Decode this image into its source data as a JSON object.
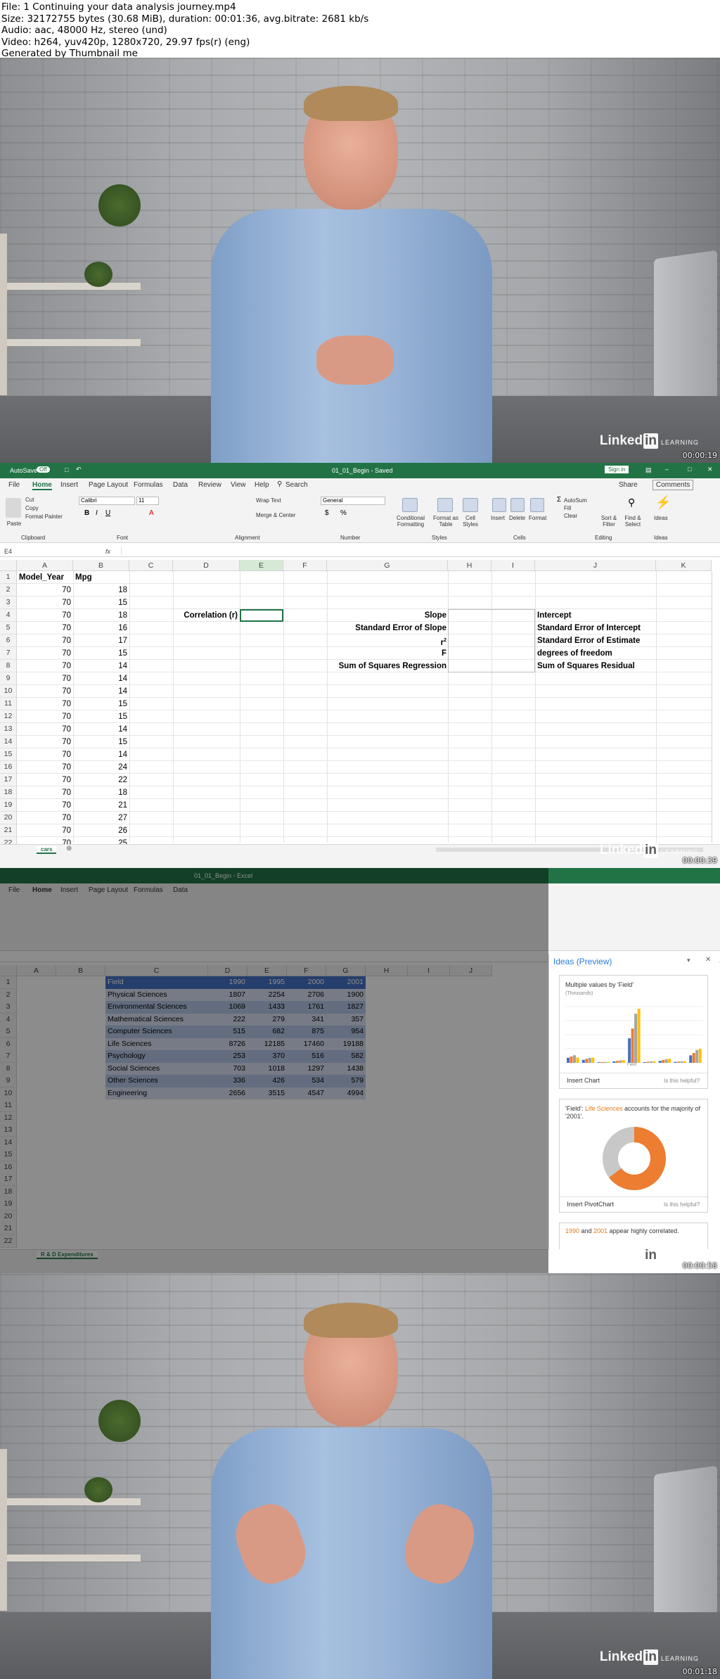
{
  "info": {
    "file": "File: 1 Continuing your data analysis journey.mp4",
    "size": "Size: 32172755 bytes (30.68 MiB), duration: 00:01:36, avg.bitrate: 2681 kb/s",
    "audio": "Audio: aac, 48000 Hz, stereo (und)",
    "video": "Video: h264, yuv420p, 1280x720, 29.97 fps(r) (eng)",
    "generator": "Generated by Thumbnail me"
  },
  "branding": {
    "logo": "Linked",
    "logo_in": "in",
    "logo_sub": "LEARNING"
  },
  "frames": [
    {
      "timestamp": "00:00:19"
    },
    {
      "timestamp": "00:00:39"
    },
    {
      "timestamp": "00:00:58"
    },
    {
      "timestamp": "00:01:18"
    }
  ],
  "excel": {
    "autosave": "AutoSave",
    "autosave_state": "Off",
    "doc_title": "01_01_Begin - Saved",
    "sign_in": "Sign in",
    "tabs": [
      "File",
      "Home",
      "Insert",
      "Page Layout",
      "Formulas",
      "Data",
      "Review",
      "View",
      "Help",
      "Search"
    ],
    "share": "Share",
    "comments": "Comments",
    "ribbon": {
      "paste": "Paste",
      "cut": "Cut",
      "copy": "Copy",
      "format_painter": "Format Painter",
      "clipboard": "Clipboard",
      "font_name": "Calibri",
      "font_size": "11",
      "font": "Font",
      "wrap_text": "Wrap Text",
      "merge_center": "Merge & Center",
      "alignment": "Alignment",
      "number_format": "General",
      "number": "Number",
      "conditional": "Conditional Formatting",
      "format_table": "Format as Table",
      "cell_styles": "Cell Styles",
      "styles": "Styles",
      "insert": "Insert",
      "delete": "Delete",
      "format": "Format",
      "cells": "Cells",
      "autosum": "AutoSum",
      "fill": "Fill",
      "clear": "Clear",
      "sort_filter": "Sort & Filter",
      "find_select": "Find & Select",
      "editing": "Editing",
      "ideas": "Ideas"
    },
    "name_box": "E4",
    "fx": "fx",
    "columns": [
      "A",
      "B",
      "C",
      "D",
      "E",
      "F",
      "G",
      "H",
      "I",
      "J",
      "K"
    ],
    "rows": [
      "1",
      "2",
      "3",
      "4",
      "5",
      "6",
      "7",
      "8",
      "9",
      "10",
      "11",
      "12",
      "13",
      "14",
      "15",
      "16",
      "17",
      "18",
      "19",
      "20",
      "21",
      "22"
    ],
    "headers": {
      "a": "Model_Year",
      "b": "Mpg"
    },
    "model_year": [
      "70",
      "70",
      "70",
      "70",
      "70",
      "70",
      "70",
      "70",
      "70",
      "70",
      "70",
      "70",
      "70",
      "70",
      "70",
      "70",
      "70",
      "70",
      "70",
      "70",
      "70"
    ],
    "mpg": [
      "18",
      "15",
      "18",
      "16",
      "17",
      "15",
      "14",
      "14",
      "14",
      "15",
      "15",
      "14",
      "15",
      "14",
      "24",
      "22",
      "18",
      "21",
      "27",
      "26",
      "25"
    ],
    "correlation_label": "Correlation (r)",
    "left_labels": [
      "Slope",
      "Standard Error of Slope",
      "r",
      "F",
      "Sum of Squares Regression"
    ],
    "r_sup": "2",
    "right_labels": [
      "Intercept",
      "Standard Error of Intercept",
      "Standard Error of Estimate",
      "degrees of freedom",
      "Sum of Squares Residual"
    ],
    "sheet_tab": "cars"
  },
  "excel2": {
    "doc_title": "01_01_Begin - Excel",
    "columns": [
      "A",
      "B",
      "C",
      "D",
      "E",
      "F",
      "G",
      "H",
      "I",
      "J"
    ],
    "table_header": [
      "Field",
      "1990",
      "1995",
      "2000",
      "2001"
    ],
    "table_rows": [
      [
        "Physical Sciences",
        "1807",
        "2254",
        "2706",
        "1900"
      ],
      [
        "Environmental Sciences",
        "1069",
        "1433",
        "1761",
        "1827"
      ],
      [
        "Mathematical Sciences",
        "222",
        "279",
        "341",
        "357"
      ],
      [
        "Computer Sciences",
        "515",
        "682",
        "875",
        "954"
      ],
      [
        "Life Sciences",
        "8726",
        "12185",
        "17460",
        "19188"
      ],
      [
        "Psychology",
        "253",
        "370",
        "516",
        "582"
      ],
      [
        "Social Sciences",
        "703",
        "1018",
        "1297",
        "1438"
      ],
      [
        "Other Sciences",
        "336",
        "426",
        "534",
        "579"
      ],
      [
        "Engineering",
        "2656",
        "3515",
        "4547",
        "4994"
      ]
    ],
    "sheet_tab": "R & D Expenditures",
    "ideas": {
      "title": "Ideas (Preview)",
      "card1_title": "Multiple values by 'Field'",
      "card1_sub": "(Thousands)",
      "card1_axis": "Field",
      "card1_action": "Insert Chart",
      "helpful": "Is this helpful?",
      "card2_pre": "'Field': ",
      "card2_highlight": "Life Sciences",
      "card2_post": " accounts for the majority of '2001'.",
      "card2_action": "Insert PivotChart",
      "card3_pre": "1990",
      "card3_mid": " and ",
      "card3_hi": "2001",
      "card3_post": " appear highly correlated."
    }
  }
}
